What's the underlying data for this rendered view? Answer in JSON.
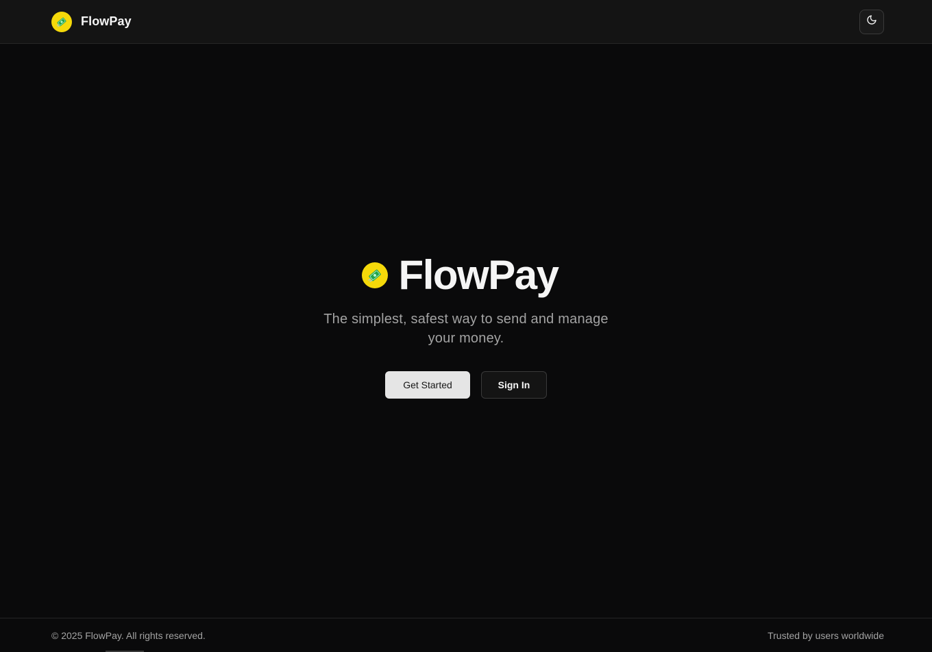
{
  "header": {
    "brand_name": "FlowPay",
    "logo_icon": "money-with-wings-icon",
    "theme_toggle_icon": "moon-icon"
  },
  "hero": {
    "title": "FlowPay",
    "subtitle": "The simplest, safest way to send and manage your money.",
    "primary_button": "Get Started",
    "secondary_button": "Sign In"
  },
  "footer": {
    "copyright": "© 2025 FlowPay. All rights reserved.",
    "tagline": "Trusted by users worldwide"
  },
  "colors": {
    "background": "#0a0a0b",
    "header_bg": "#141414",
    "brand_yellow": "#f5d90a",
    "money_green": "#22a34a",
    "text_primary": "#f5f5f5",
    "text_muted": "#a3a3a3",
    "primary_button_bg": "#e5e5e5"
  }
}
